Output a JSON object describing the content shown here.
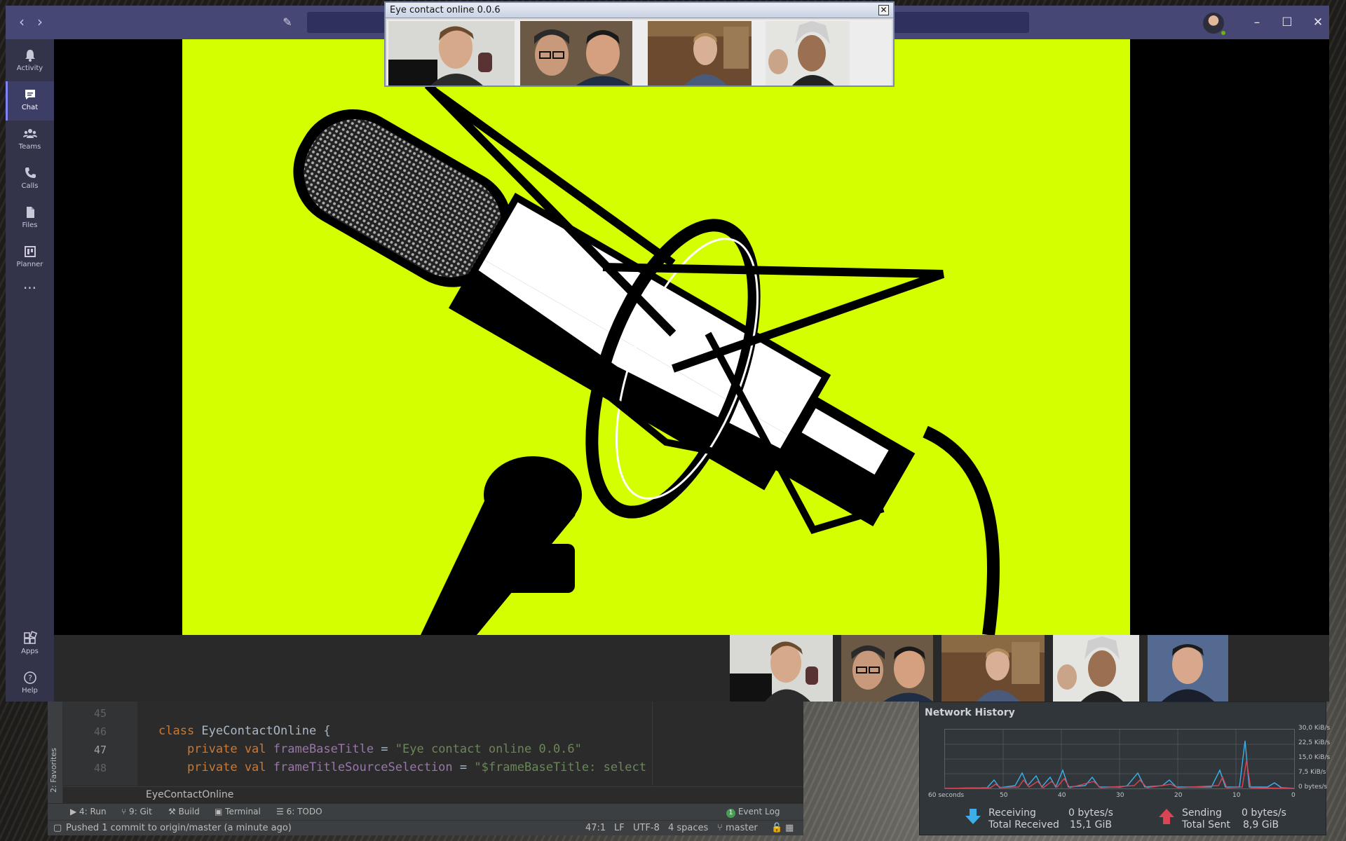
{
  "teams": {
    "rail": [
      {
        "label": "Activity",
        "icon": "bell-icon"
      },
      {
        "label": "Chat",
        "icon": "chat-icon"
      },
      {
        "label": "Teams",
        "icon": "teams-icon"
      },
      {
        "label": "Calls",
        "icon": "phone-icon"
      },
      {
        "label": "Files",
        "icon": "file-icon"
      },
      {
        "label": "Planner",
        "icon": "planner-icon"
      },
      {
        "label": "",
        "icon": "more-icon"
      },
      {
        "label": "Apps",
        "icon": "apps-icon"
      },
      {
        "label": "Help",
        "icon": "help-icon"
      }
    ],
    "accent": "#464775",
    "shared_screen_color": "#d4ff00"
  },
  "eye_contact": {
    "title": "Eye contact online 0.0.6"
  },
  "ide": {
    "favorites_label": "2: Favorites",
    "line_numbers": [
      "45",
      "46",
      "47",
      "48"
    ],
    "code": {
      "line46_kw": "class",
      "line46_rest": " EyeContactOnline {",
      "line47_kw": "    private val",
      "line47_name": " frameBaseTitle",
      "line47_eq": " = ",
      "line47_str": "\"Eye contact online 0.0.6\"",
      "line48_kw": "    private val",
      "line48_name": " frameTitleSourceSelection",
      "line48_eq": " = ",
      "line48_str": "\"$frameBaseTitle: select"
    },
    "breadcrumb": "EyeContactOnline",
    "tool_windows": {
      "run": "4: Run",
      "git": "9: Git",
      "build": "Build",
      "terminal": "Terminal",
      "todo": "6: TODO",
      "event_log": "Event Log",
      "event_log_count": "1"
    },
    "status": {
      "message": "Pushed 1 commit to origin/master (a minute ago)",
      "position": "47:1",
      "line_sep": "LF",
      "encoding": "UTF-8",
      "indent": "4 spaces",
      "branch": "master"
    }
  },
  "network": {
    "title": "Network History",
    "y_ticks": [
      "30,0 KiB/s",
      "22,5 KiB/s",
      "15,0 KiB/s",
      "7,5 KiB/s",
      "0 bytes/s"
    ],
    "x_ticks": [
      "60 seconds",
      "50",
      "40",
      "30",
      "20",
      "10",
      "0"
    ],
    "receiving_label": "Receiving",
    "receiving_rate": "0 bytes/s",
    "total_received_label": "Total Received",
    "total_received": "15,1 GiB",
    "sending_label": "Sending",
    "sending_rate": "0 bytes/s",
    "total_sent_label": "Total Sent",
    "total_sent": "8,9 GiB",
    "receiving_color": "#3daee9",
    "sending_color": "#da4453"
  }
}
